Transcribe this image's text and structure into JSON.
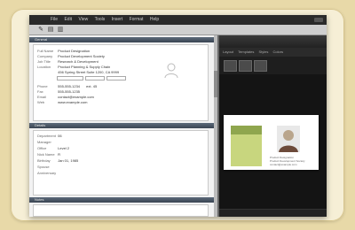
{
  "menu": {
    "items": [
      "File",
      "Edit",
      "View",
      "Tools",
      "Insert",
      "Format",
      "Help"
    ]
  },
  "toolbar": {
    "buttons": [
      "new-icon",
      "open-icon",
      "save-icon"
    ]
  },
  "left": {
    "section1_title": "General",
    "fields": [
      {
        "label": "Full Name",
        "value": "Product Designation"
      },
      {
        "label": "Company",
        "value": "Product Development Society"
      },
      {
        "label": "Job Title",
        "value": "Research & Development"
      },
      {
        "label": "Location",
        "value": "Product Planning & Supply Chain"
      },
      {
        "label": "",
        "value": "456 Spring Street Suite 1200, CA 9999"
      }
    ],
    "phone_label": "Phone",
    "phone_value": "555-555-1234",
    "ext_value": "ext. 45",
    "fax_label": "Fax",
    "fax_value": "555-555-1235",
    "email_label": "Email",
    "email_value": "contact@example.com",
    "web_label": "Web",
    "web_value": "www.example.com",
    "section2_title": "Details",
    "details": [
      {
        "label": "Department",
        "value": "06"
      },
      {
        "label": "Manager",
        "value": ""
      },
      {
        "label": "Office",
        "value": "Level 2"
      },
      {
        "label": "Nick Name",
        "value": "R"
      },
      {
        "label": "Birthday",
        "value": "Jan 01, 1985"
      },
      {
        "label": "Spouse",
        "value": ""
      },
      {
        "label": "Anniversary",
        "value": ""
      }
    ],
    "section3_title": "Notes"
  },
  "right": {
    "tabs": [
      "Layout",
      "Templates",
      "Styles",
      "Colors"
    ],
    "card": {
      "name": "Product Designation",
      "line1": "Product Development Society",
      "line2": "contact@example.com"
    }
  }
}
